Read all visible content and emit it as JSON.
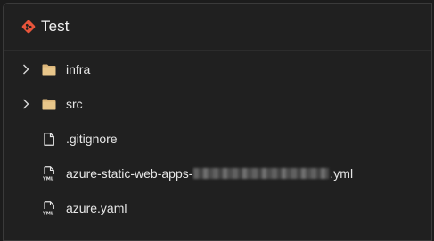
{
  "header": {
    "title": "Test",
    "icon": "git-icon",
    "icon_color": "#e8553b"
  },
  "tree": {
    "items": [
      {
        "label": "infra",
        "type": "folder",
        "expandable": true,
        "icon": "folder-icon"
      },
      {
        "label": "src",
        "type": "folder",
        "expandable": true,
        "icon": "folder-icon"
      },
      {
        "label": ".gitignore",
        "type": "file",
        "expandable": false,
        "icon": "file-icon"
      },
      {
        "label_prefix": "azure-static-web-apps-",
        "label_suffix": ".yml",
        "type": "yml",
        "expandable": false,
        "icon": "yml-icon"
      },
      {
        "label": "azure.yaml",
        "type": "yml",
        "expandable": false,
        "icon": "yml-icon"
      }
    ]
  },
  "colors": {
    "folder": "#dcb67a",
    "background": "#202020",
    "text": "#e6e6e6"
  }
}
